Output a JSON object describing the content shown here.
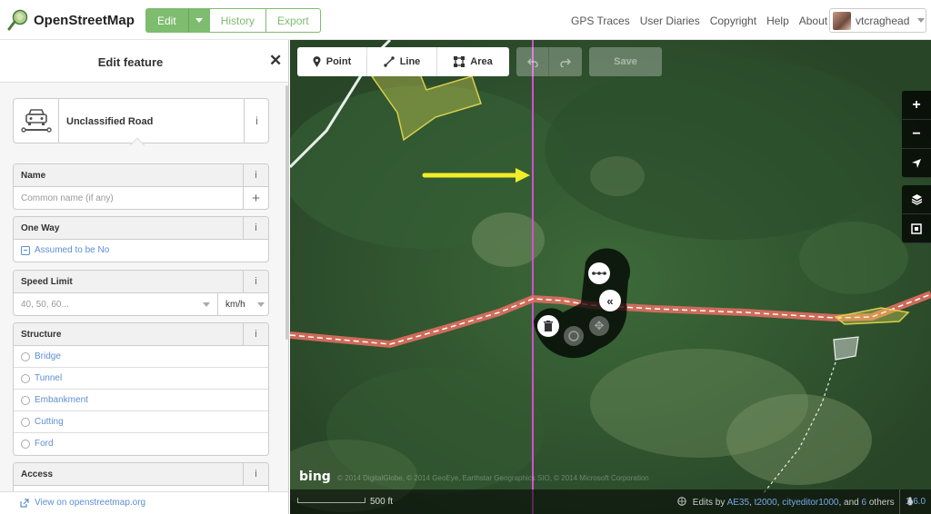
{
  "app": {
    "title": "OpenStreetMap",
    "nav": {
      "edit": "Edit",
      "history": "History",
      "export": "Export"
    },
    "links": [
      "GPS Traces",
      "User Diaries",
      "Copyright",
      "Help",
      "About"
    ],
    "user": "vtcraghead",
    "brand_color": "#7ebc6f"
  },
  "sidebar": {
    "title": "Edit feature",
    "close": "✕",
    "preset": {
      "label": "Unclassified Road",
      "icon": "car-icon",
      "info": "i"
    },
    "fields": {
      "name": {
        "label": "Name",
        "placeholder": "Common name (if any)",
        "add": "+"
      },
      "oneway": {
        "label": "One Way",
        "value": "Assumed to be No"
      },
      "speed": {
        "label": "Speed Limit",
        "placeholder": "40, 50, 60...",
        "unit": "km/h"
      },
      "structure": {
        "label": "Structure",
        "options": [
          "Bridge",
          "Tunnel",
          "Embankment",
          "Cutting",
          "Ford"
        ]
      },
      "access": {
        "label": "Access"
      }
    },
    "info_glyph": "i",
    "footer_link": "View on openstreetmap.org"
  },
  "toolbar": {
    "point": "Point",
    "line": "Line",
    "area": "Area",
    "save": "Save"
  },
  "map_controls": {
    "zoom_in": "+",
    "zoom_out": "−",
    "locate": "➤"
  },
  "footer": {
    "scale": "500 ft",
    "bing": "bing",
    "imagery_credit": "© 2014 DigitalGlobe, © 2014 GeoEye, Earthstar Geographics SIO, © 2014 Microsoft Corporation",
    "edits_prefix": "Edits by ",
    "editor1": "AE35",
    "editor2": "t2000",
    "editor3": "cityeditor1000",
    "edits_and": ", and ",
    "others_count": "6",
    "edits_suffix": " others",
    "version": "1.6.0"
  }
}
